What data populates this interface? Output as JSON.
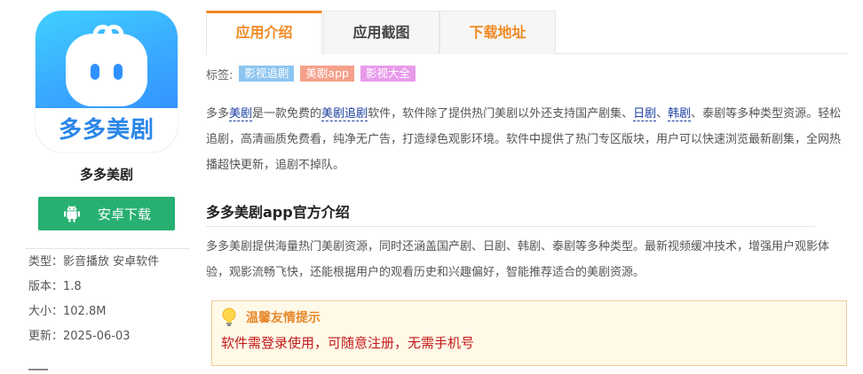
{
  "app": {
    "icon_text": "多多美剧",
    "name": "多多美剧",
    "download_label": "安卓下载",
    "meta": [
      {
        "key": "类型：",
        "value": "影音播放 安卓软件"
      },
      {
        "key": "版本：",
        "value": "1.8"
      },
      {
        "key": "大小：",
        "value": "102.8M"
      },
      {
        "key": "更新：",
        "value": "2025-06-03"
      }
    ]
  },
  "tabs": [
    {
      "label": "应用介绍",
      "active": true
    },
    {
      "label": "应用截图",
      "active": false
    },
    {
      "label": "下载地址",
      "active": false
    }
  ],
  "tags": {
    "label": "标签:",
    "items": [
      "影视追剧",
      "美剧app",
      "影视大全"
    ]
  },
  "intro": {
    "s1": "多多",
    "l1": "美剧",
    "s2": "是一款免费的",
    "l2": "美剧追剧",
    "s3": "软件，软件除了提供热门美剧以外还支持国产剧集、",
    "l3": "日剧",
    "s4": "、",
    "l4": "韩剧",
    "s5": "、泰剧等多种类型资源。轻松追剧，高清画质免费看，纯净无广告，打造绿色观影环境。软件中提供了热门专区版块，用户可以快速浏览最新剧集，全网热播超快更新，追剧不掉队。"
  },
  "section": {
    "title": "多多美剧app官方介绍",
    "text": "多多美剧提供海量热门美剧资源，同时还涵盖国产剧、日剧、韩剧、泰剧等多种类型。最新视频缓冲技术，增强用户观影体验，观影流畅飞快，还能根据用户的观看历史和兴趣偏好，智能推荐适合的美剧资源。"
  },
  "tip": {
    "title": "温馨友情提示",
    "text": "软件需登录使用，可随意注册，无需手机号"
  },
  "colors": {
    "accent": "#f08a24",
    "download_green": "#27b071",
    "link": "#1a3ea1",
    "tip_red": "#c21a1a"
  }
}
